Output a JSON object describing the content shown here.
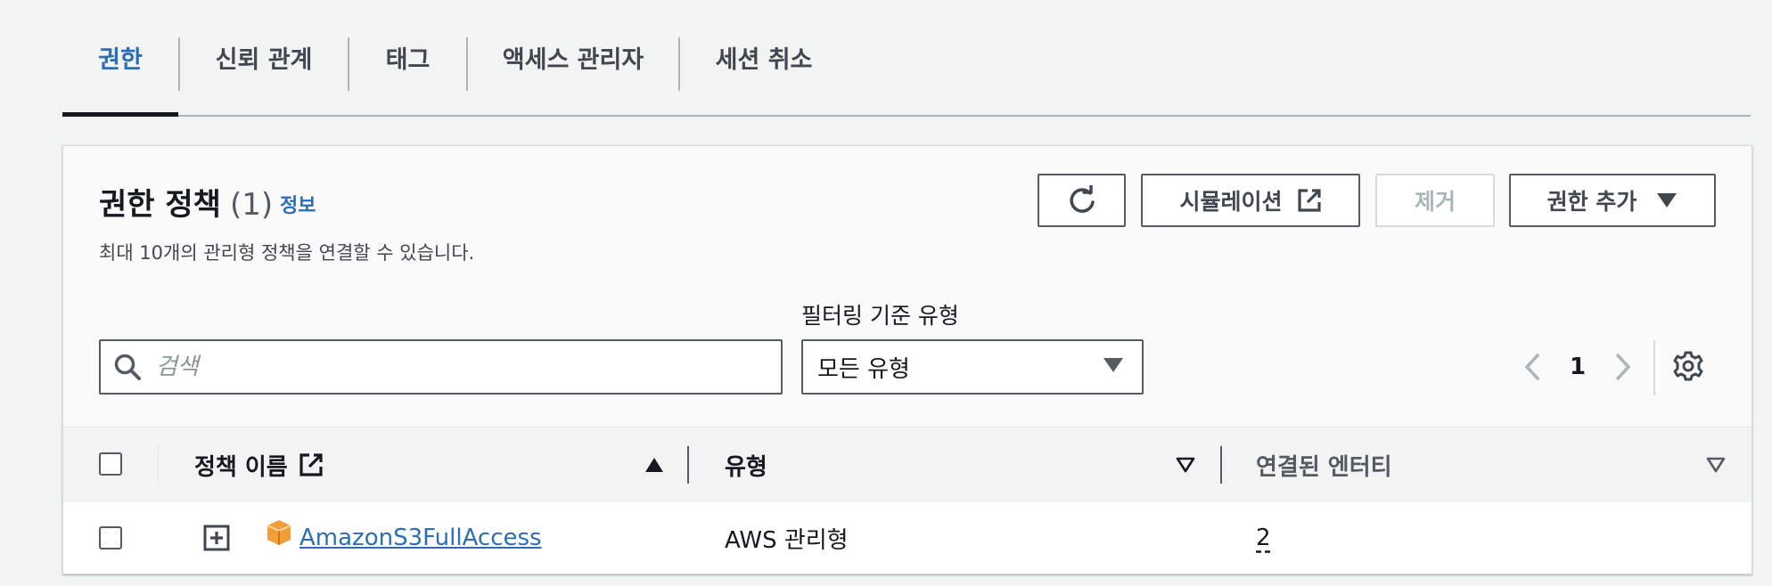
{
  "tabs": [
    {
      "label": "권한",
      "active": true
    },
    {
      "label": "신뢰 관계"
    },
    {
      "label": "태그"
    },
    {
      "label": "액세스 관리자"
    },
    {
      "label": "세션 취소"
    }
  ],
  "panel": {
    "title": "권한 정책",
    "count": "(1)",
    "info_link": "정보",
    "description": "최대 10개의 관리형 정책을 연결할 수 있습니다.",
    "buttons": {
      "refresh_icon": "refresh-icon",
      "simulate": "시뮬레이션",
      "remove": "제거",
      "add_permissions": "권한 추가"
    },
    "filter": {
      "search_placeholder": "검색",
      "type_label": "필터링 기준 유형",
      "type_selected": "모든 유형"
    },
    "pagination": {
      "current_page": "1"
    }
  },
  "table": {
    "columns": {
      "name": "정책 이름",
      "type": "유형",
      "attached_entities": "연결된 엔터티"
    },
    "rows": [
      {
        "name": "AmazonS3FullAccess",
        "type": "AWS 관리형",
        "attached_entities": "2"
      }
    ]
  },
  "colors": {
    "link": "#2c6eb5",
    "text": "#16191f",
    "border": "#545b64",
    "s3_icon": "#f19e38"
  }
}
